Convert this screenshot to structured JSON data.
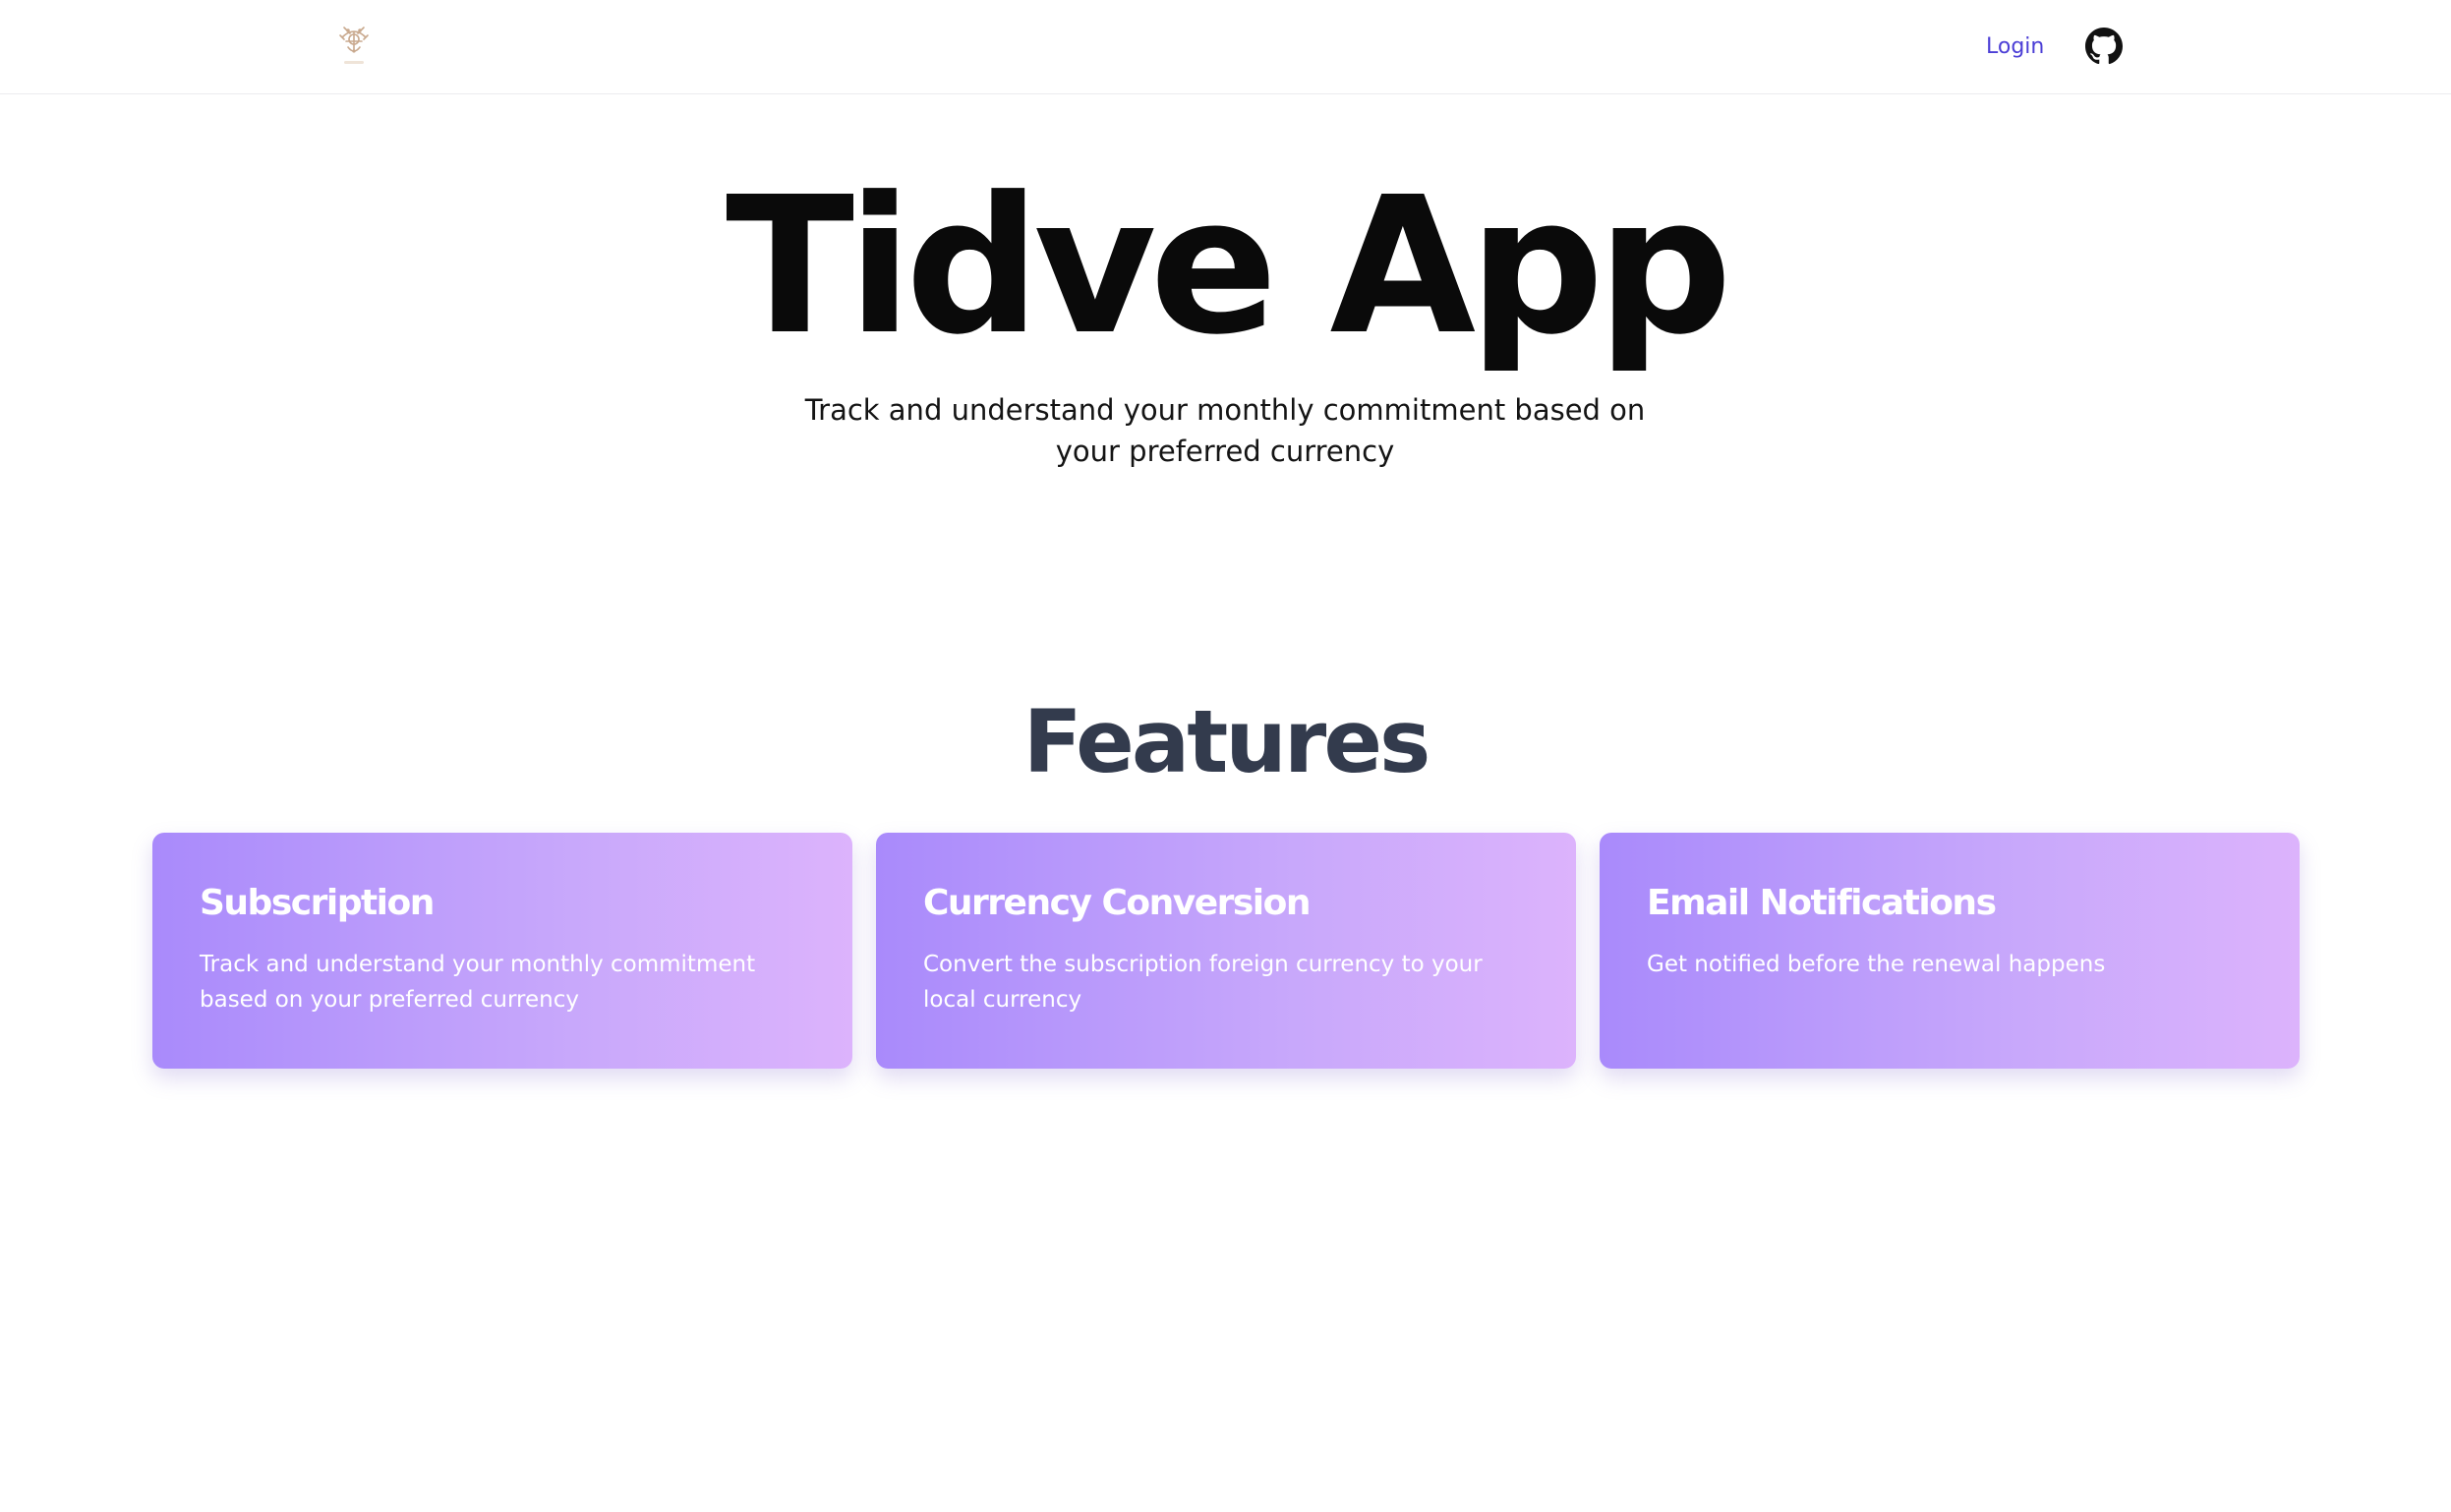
{
  "header": {
    "logo_icon": "tidve-logo-icon",
    "login_label": "Login",
    "github_icon": "github-icon"
  },
  "hero": {
    "title": "Tidve App",
    "subtitle": "Track and understand your monthly commitment based on your preferred currency"
  },
  "features": {
    "title": "Features",
    "items": [
      {
        "title": "Subscription",
        "description": "Track and understand your monthly commitment based on your preferred currency"
      },
      {
        "title": "Currency Conversion",
        "description": "Convert the subscription foreign currency to your local currency"
      },
      {
        "title": "Email Notifications",
        "description": "Get notified before the renewal happens"
      }
    ]
  },
  "colors": {
    "link": "#4c3fd6",
    "card_gradient_start": "#a98afb",
    "card_gradient_end": "#dcb3fc",
    "features_title": "#333b4d"
  }
}
